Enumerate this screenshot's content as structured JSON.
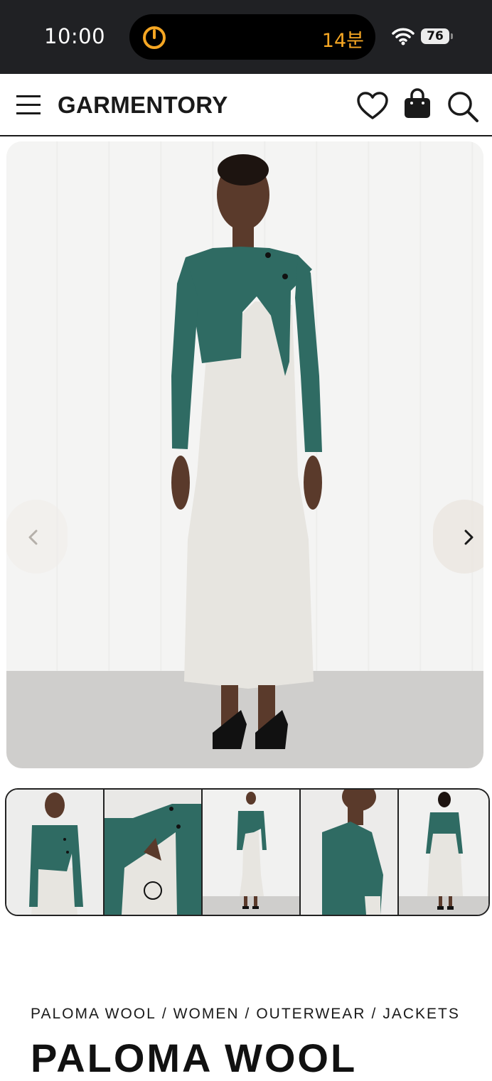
{
  "status_bar": {
    "time": "10:00",
    "island_count": "14분",
    "battery": "76",
    "accent": "#f5a623"
  },
  "header": {
    "logo": "GARMENTORY",
    "icons": [
      "menu-icon",
      "heart-icon",
      "bag-icon",
      "search-icon"
    ]
  },
  "gallery": {
    "prev_icon": "chevron-left-icon",
    "next_icon": "chevron-right-icon",
    "thumbnail_count": 5
  },
  "breadcrumb": {
    "items": [
      "PALOMA WOOL",
      "WOMEN",
      "OUTERWEAR",
      "JACKETS"
    ],
    "separator": "/"
  },
  "product": {
    "brand": "PALOMA WOOL"
  },
  "colors": {
    "cardigan": "#2f6b63",
    "dress": "#e7e5e0",
    "skin": "#5a3a2b"
  }
}
